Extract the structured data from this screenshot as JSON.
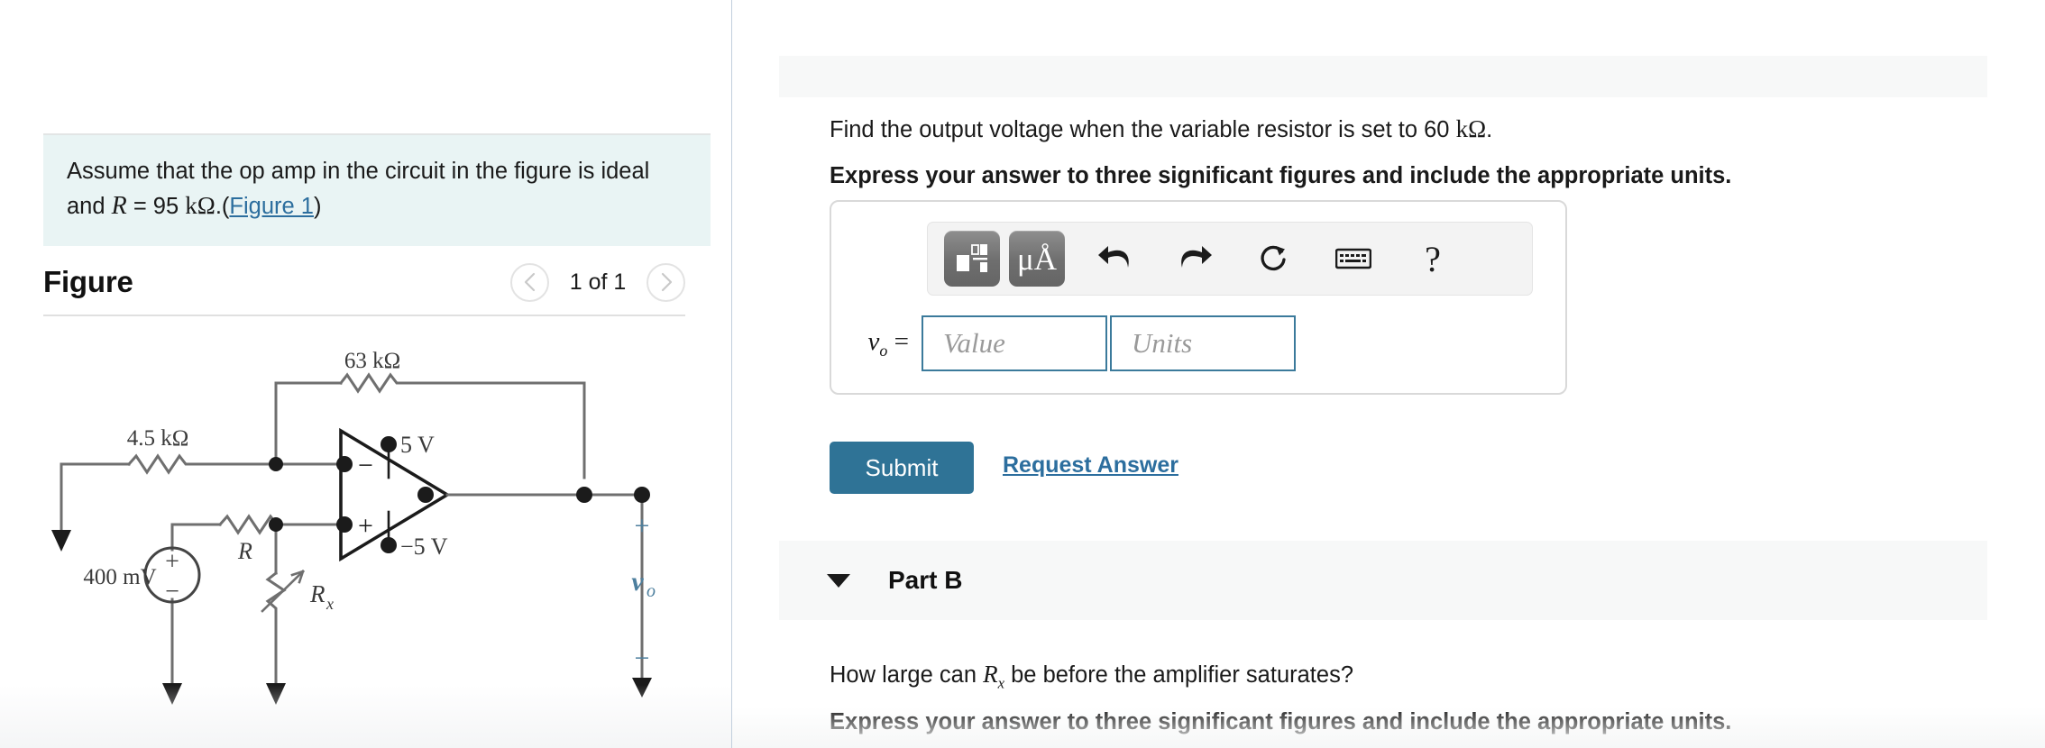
{
  "left": {
    "info": {
      "line1": "Assume that the op amp in the circuit in the figure is ideal",
      "line2_prefix": "and ",
      "line2_symbol": "R",
      "line2_eq": " = 95 ",
      "line2_unit": "kΩ",
      "line2_dot": ".(",
      "figure_link": "Figure 1",
      "line2_close": ")"
    },
    "figure": {
      "title": "Figure",
      "counter": "1 of 1",
      "prev_icon": "chevron-left-icon",
      "next_icon": "chevron-right-icon"
    },
    "circuit": {
      "feedback_resistor": "63 kΩ",
      "input_resistor": "4.5 kΩ",
      "bias_resistor": "R",
      "variable_resistor": "R",
      "variable_resistor_sub": "x",
      "source_value": "400 mV",
      "source_plus": "+",
      "source_minus": "−",
      "supply_pos": "5 V",
      "supply_neg": "−5 V",
      "opamp_inverting": "−",
      "opamp_noninverting": "+",
      "out_plus": "+",
      "out_minus": "−",
      "out_label": "v",
      "out_label_sub": "o"
    }
  },
  "right": {
    "part_a": {
      "prompt_pre": "Find the output voltage when the variable resistor is set to 60 ",
      "prompt_unit": "kΩ",
      "prompt_post": ".",
      "instruction": "Express your answer to three significant figures and include the appropriate units.",
      "answer": {
        "label": "v",
        "label_sub": "o",
        "equals": "=",
        "value_placeholder": "Value",
        "value": "",
        "units_placeholder": "Units",
        "units": ""
      },
      "toolbar": {
        "template_icon": "math-template-icon",
        "units_icon": "micro-angstrom-units-icon",
        "units_text": "μÅ",
        "undo_icon": "undo-arrow-icon",
        "redo_icon": "redo-arrow-icon",
        "reset_icon": "reset-circular-arrow-icon",
        "keyboard_icon": "keyboard-icon",
        "help_icon": "help-question-icon",
        "help_text": "?"
      },
      "submit_label": "Submit",
      "request_answer_label": "Request Answer"
    },
    "part_b": {
      "caret_icon": "caret-down-icon",
      "title": "Part B",
      "prompt_pre": "How large can ",
      "prompt_symbol": "R",
      "prompt_symbol_sub": "x",
      "prompt_post": " be before the amplifier saturates?",
      "instruction": "Express your answer to three significant figures and include the appropriate units."
    }
  },
  "colors": {
    "info_box_bg": "#e9f4f4",
    "link": "#2c6e9e",
    "submit_bg": "#2f7396",
    "input_border": "#3b7a9b",
    "panel_divider": "#c2cfdd",
    "circuit_wire": "#6f6f6f",
    "circuit_accent": "#4d7f9e",
    "section_bar_bg": "#f7f8f8"
  }
}
